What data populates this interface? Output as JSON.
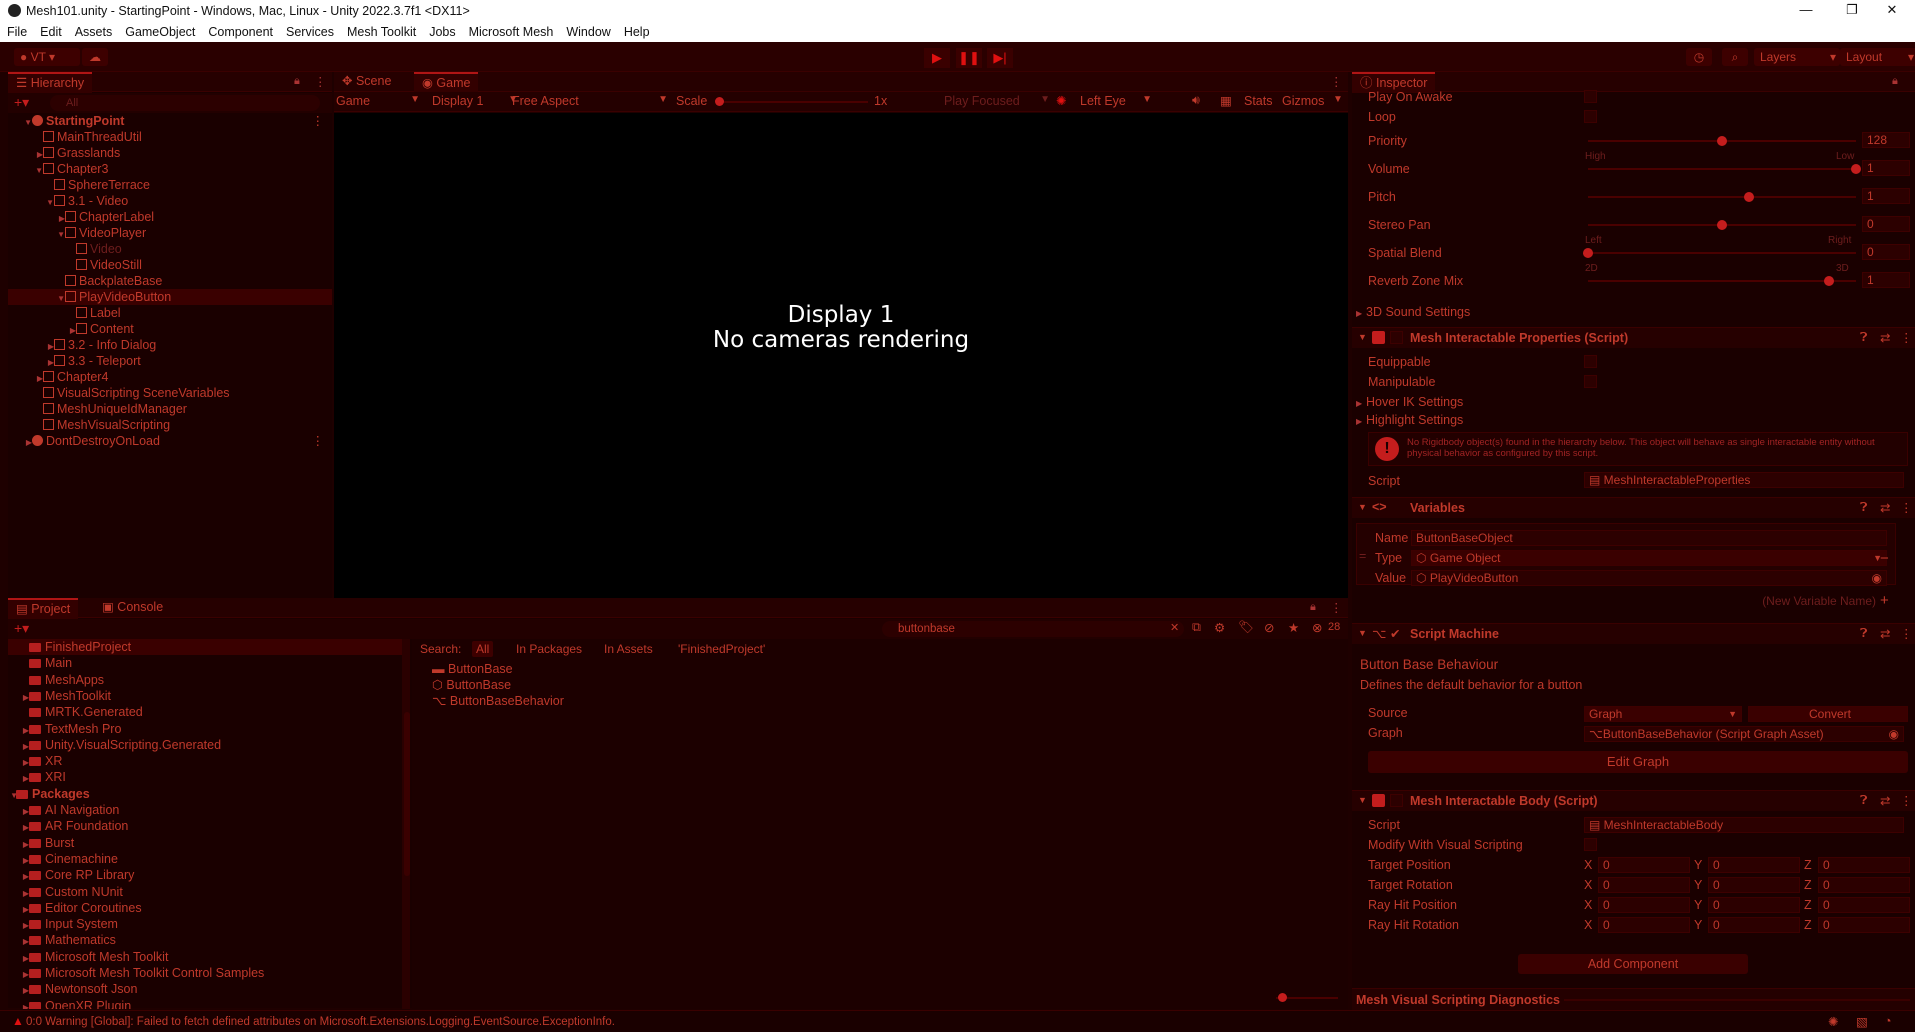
{
  "window": {
    "title": "Mesh101.unity - StartingPoint - Windows, Mac, Linux - Unity 2022.3.7f1 <DX11>",
    "controls": [
      "—",
      "❐",
      "✕"
    ]
  },
  "menu": [
    "File",
    "Edit",
    "Assets",
    "GameObject",
    "Component",
    "Services",
    "Mesh Toolkit",
    "Jobs",
    "Microsoft Mesh",
    "Window",
    "Help"
  ],
  "toolbar": {
    "account_label": "VT",
    "layers_label": "Layers",
    "layout_label": "Layout"
  },
  "hierarchy": {
    "tab": "Hierarchy",
    "search_placeholder": "All",
    "items": [
      {
        "label": "StartingPoint",
        "depth": 0,
        "arrow": "▼",
        "bold": true,
        "icon": "scene-icon"
      },
      {
        "label": "MainThreadUtil",
        "depth": 1,
        "arrow": "",
        "icon": "gameobject-icon"
      },
      {
        "label": "Grasslands",
        "depth": 1,
        "arrow": "▶",
        "icon": "gameobject-icon"
      },
      {
        "label": "Chapter3",
        "depth": 1,
        "arrow": "▼",
        "icon": "gameobject-icon"
      },
      {
        "label": "SphereTerrace",
        "depth": 2,
        "arrow": "",
        "icon": "gameobject-icon"
      },
      {
        "label": "3.1 - Video",
        "depth": 2,
        "arrow": "▼",
        "icon": "gameobject-icon"
      },
      {
        "label": "ChapterLabel",
        "depth": 3,
        "arrow": "▶",
        "icon": "gameobject-icon"
      },
      {
        "label": "VideoPlayer",
        "depth": 3,
        "arrow": "▼",
        "icon": "gameobject-icon"
      },
      {
        "label": "Video",
        "depth": 4,
        "arrow": "",
        "icon": "gameobject-icon",
        "dim": true
      },
      {
        "label": "VideoStill",
        "depth": 4,
        "arrow": "",
        "icon": "gameobject-icon"
      },
      {
        "label": "BackplateBase",
        "depth": 3,
        "arrow": "",
        "icon": "gameobject-icon"
      },
      {
        "label": "PlayVideoButton",
        "depth": 3,
        "arrow": "▼",
        "icon": "gameobject-icon",
        "selected": true
      },
      {
        "label": "Label",
        "depth": 4,
        "arrow": "",
        "icon": "gameobject-icon"
      },
      {
        "label": "Content",
        "depth": 4,
        "arrow": "▶",
        "icon": "gameobject-icon"
      },
      {
        "label": "3.2 - Info Dialog",
        "depth": 2,
        "arrow": "▶",
        "icon": "gameobject-icon"
      },
      {
        "label": "3.3 - Teleport",
        "depth": 2,
        "arrow": "▶",
        "icon": "gameobject-icon"
      },
      {
        "label": "Chapter4",
        "depth": 1,
        "arrow": "▶",
        "icon": "gameobject-icon"
      },
      {
        "label": "VisualScripting SceneVariables",
        "depth": 1,
        "arrow": "",
        "icon": "gameobject-icon"
      },
      {
        "label": "MeshUniqueIdManager",
        "depth": 1,
        "arrow": "",
        "icon": "gameobject-icon"
      },
      {
        "label": "MeshVisualScripting",
        "depth": 1,
        "arrow": "",
        "icon": "gameobject-icon"
      },
      {
        "label": "DontDestroyOnLoad",
        "depth": 0,
        "arrow": "▶",
        "icon": "scene-icon"
      }
    ]
  },
  "scene_tabs": {
    "scene": "Scene",
    "game": "Game"
  },
  "game_toolbar": {
    "mode": "Game",
    "display": "Display 1",
    "aspect": "Free Aspect",
    "scale_label": "Scale",
    "scale_value": "1x",
    "play_focused": "Play Focused",
    "eye": "Left Eye",
    "stats": "Stats",
    "gizmos": "Gizmos"
  },
  "game_view": {
    "line1": "Display 1",
    "line2": "No cameras rendering"
  },
  "project": {
    "tab_project": "Project",
    "tab_console": "Console",
    "search_value": "buttonbase",
    "hidden_count": "28",
    "search_label": "Search:",
    "filters": [
      "All",
      "In Packages",
      "In Assets",
      "'FinishedProject'"
    ],
    "tree": [
      {
        "label": "FinishedProject",
        "depth": 1,
        "arrow": "",
        "selected": true
      },
      {
        "label": "Main",
        "depth": 1,
        "arrow": ""
      },
      {
        "label": "MeshApps",
        "depth": 1,
        "arrow": ""
      },
      {
        "label": "MeshToolkit",
        "depth": 1,
        "arrow": "▶"
      },
      {
        "label": "MRTK.Generated",
        "depth": 1,
        "arrow": ""
      },
      {
        "label": "TextMesh Pro",
        "depth": 1,
        "arrow": "▶"
      },
      {
        "label": "Unity.VisualScripting.Generated",
        "depth": 1,
        "arrow": "▶"
      },
      {
        "label": "XR",
        "depth": 1,
        "arrow": "▶"
      },
      {
        "label": "XRI",
        "depth": 1,
        "arrow": "▶"
      },
      {
        "label": "Packages",
        "depth": 0,
        "arrow": "▼",
        "bold": true
      },
      {
        "label": "AI Navigation",
        "depth": 1,
        "arrow": "▶"
      },
      {
        "label": "AR Foundation",
        "depth": 1,
        "arrow": "▶"
      },
      {
        "label": "Burst",
        "depth": 1,
        "arrow": "▶"
      },
      {
        "label": "Cinemachine",
        "depth": 1,
        "arrow": "▶"
      },
      {
        "label": "Core RP Library",
        "depth": 1,
        "arrow": "▶"
      },
      {
        "label": "Custom NUnit",
        "depth": 1,
        "arrow": "▶"
      },
      {
        "label": "Editor Coroutines",
        "depth": 1,
        "arrow": "▶"
      },
      {
        "label": "Input System",
        "depth": 1,
        "arrow": "▶"
      },
      {
        "label": "Mathematics",
        "depth": 1,
        "arrow": "▶"
      },
      {
        "label": "Microsoft Mesh Toolkit",
        "depth": 1,
        "arrow": "▶"
      },
      {
        "label": "Microsoft Mesh Toolkit Control Samples",
        "depth": 1,
        "arrow": "▶"
      },
      {
        "label": "Newtonsoft Json",
        "depth": 1,
        "arrow": "▶"
      },
      {
        "label": "OpenXR Plugin",
        "depth": 1,
        "arrow": "▶"
      }
    ],
    "results": [
      {
        "label": "ButtonBase",
        "icon": "folder-icon"
      },
      {
        "label": "ButtonBase",
        "icon": "prefab-icon"
      },
      {
        "label": "ButtonBaseBehavior",
        "icon": "script-graph-icon"
      }
    ]
  },
  "inspector": {
    "tab": "Inspector",
    "audio": {
      "play_on_awake": "Play On Awake",
      "loop": "Loop",
      "priority_label": "Priority",
      "priority_value": "128",
      "priority_min": "High",
      "priority_max": "Low",
      "volume_label": "Volume",
      "volume_value": "1",
      "pitch_label": "Pitch",
      "pitch_value": "1",
      "stereo_pan_label": "Stereo Pan",
      "stereo_pan_value": "0",
      "stereo_min": "Left",
      "stereo_max": "Right",
      "spatial_blend_label": "Spatial Blend",
      "spatial_blend_value": "0",
      "spatial_min": "2D",
      "spatial_max": "3D",
      "reverb_label": "Reverb Zone Mix",
      "reverb_value": "1",
      "sound_settings": "3D Sound Settings",
      "priority_level": 0.5,
      "volume_level": 1.0,
      "pitch_level": 0.6,
      "stereo_level": 0.5,
      "spatial_level": 0.0,
      "reverb_level": 0.9
    },
    "mesh_interactable_props": {
      "title": "Mesh Interactable Properties (Script)",
      "equippable": "Equippable",
      "manipulable": "Manipulable",
      "hover_ik": "Hover IK Settings",
      "highlight": "Highlight Settings",
      "warning": "No Rigidbody object(s) found in the hierarchy below. This object will behave as single interactable entity without physical behavior as configured by this script.",
      "script_label": "Script",
      "script_value": "MeshInteractableProperties"
    },
    "variables": {
      "title": "Variables",
      "name_label": "Name",
      "name_value": "ButtonBaseObject",
      "type_label": "Type",
      "type_value": "Game Object",
      "value_label": "Value",
      "value_value": "PlayVideoButton",
      "new_var_placeholder": "(New Variable Name)"
    },
    "script_machine": {
      "title": "Script Machine",
      "graph_title": "Button Base Behaviour",
      "graph_desc": "Defines the default behavior for a button",
      "source_label": "Source",
      "source_value": "Graph",
      "convert": "Convert",
      "graph_label": "Graph",
      "graph_value": "ButtonBaseBehavior (Script Graph Asset)",
      "edit_graph": "Edit Graph"
    },
    "mesh_interactable_body": {
      "title": "Mesh Interactable Body (Script)",
      "script_label": "Script",
      "script_value": "MeshInteractableBody",
      "modify_label": "Modify With Visual Scripting",
      "rows": [
        {
          "label": "Target Position",
          "x": "0",
          "y": "0",
          "z": "0"
        },
        {
          "label": "Target Rotation",
          "x": "0",
          "y": "0",
          "z": "0"
        },
        {
          "label": "Ray Hit Position",
          "x": "0",
          "y": "0",
          "z": "0"
        },
        {
          "label": "Ray Hit Rotation",
          "x": "0",
          "y": "0",
          "z": "0"
        }
      ],
      "axis_x": "X",
      "axis_y": "Y",
      "axis_z": "Z"
    },
    "add_component": "Add Component",
    "diagnostics": "Mesh Visual Scripting Diagnostics"
  },
  "status": {
    "message": "0:0 Warning [Global]: Failed to fetch defined attributes on Microsoft.Extensions.Logging.EventSource.ExceptionInfo."
  },
  "colors": {
    "background": "#1e0000",
    "text": "#c0392b",
    "accent": "#e01010"
  }
}
